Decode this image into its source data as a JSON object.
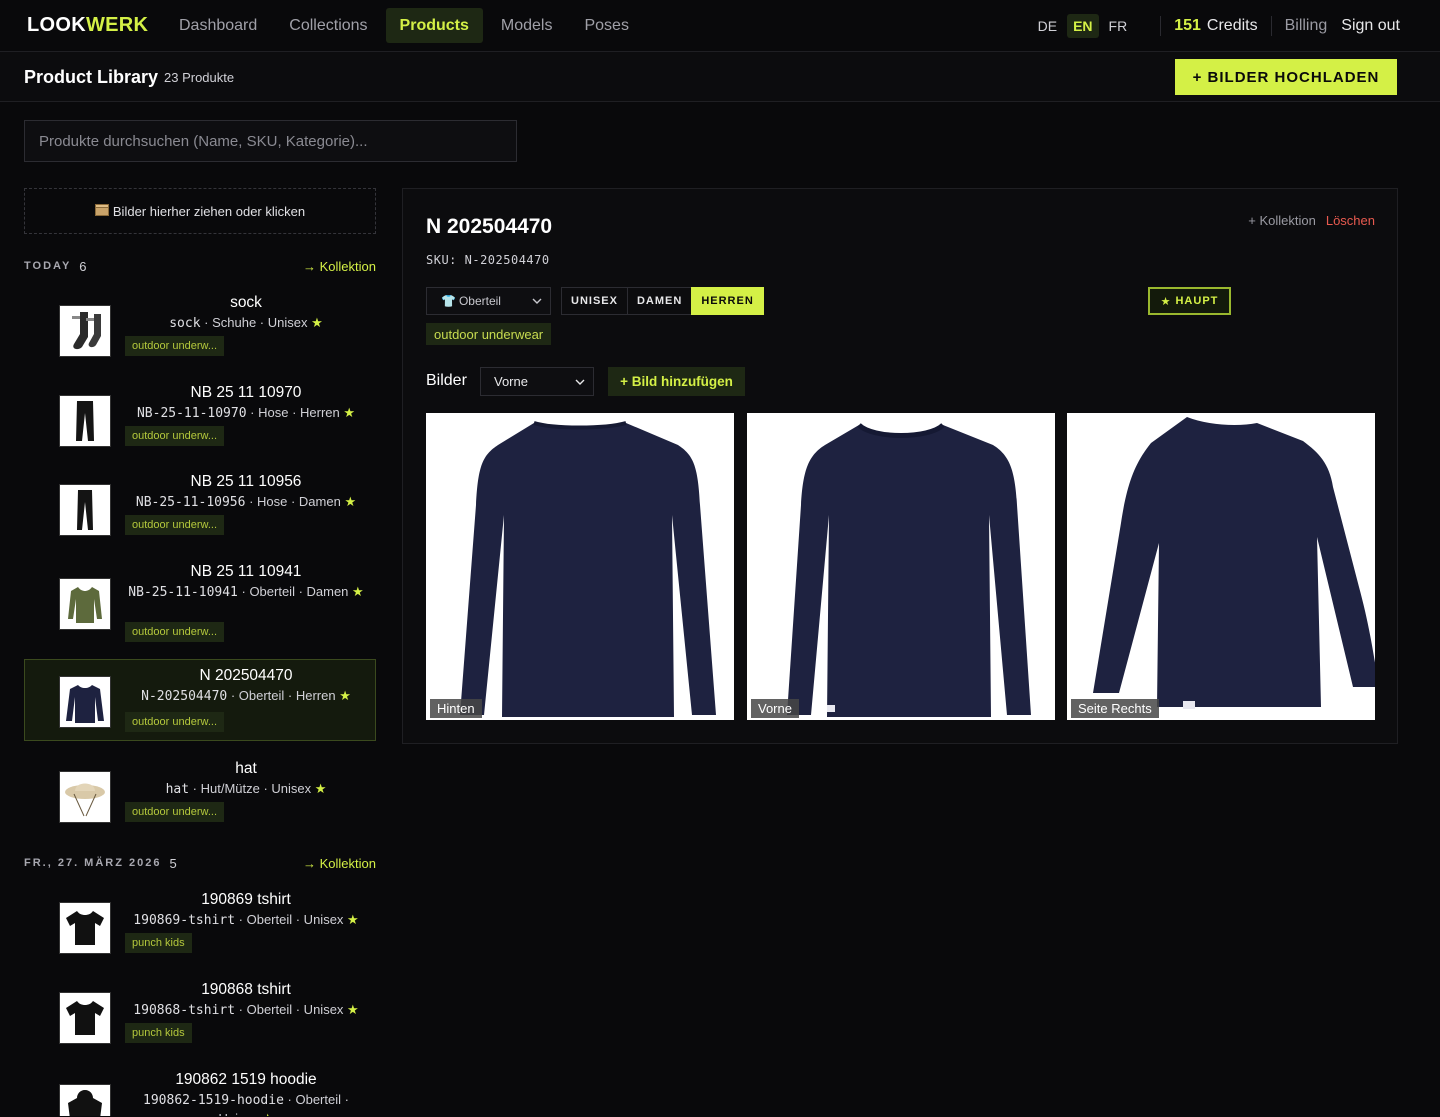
{
  "brand": {
    "logo_a": "LOOK",
    "logo_b": "WERK"
  },
  "nav": {
    "items": [
      "Dashboard",
      "Collections",
      "Products",
      "Models",
      "Poses"
    ],
    "active": "Products"
  },
  "lang": [
    "DE",
    "EN",
    "FR"
  ],
  "lang_active": "EN",
  "credits": {
    "amount": "151",
    "label": "Credits"
  },
  "billing": "Billing",
  "signout": "Sign out",
  "header": {
    "title": "Product Library",
    "count": "23 Produkte",
    "upload": "+ BILDER HOCHLADEN"
  },
  "search": {
    "placeholder": "Produkte durchsuchen (Name, SKU, Kategorie)..."
  },
  "dropzone": {
    "icon": "box-icon",
    "text": "Bilder hierher ziehen oder klicken"
  },
  "groups": [
    {
      "label": "TODAY",
      "count": "6",
      "link": "→ Kollektion"
    },
    {
      "label": "FR., 27. MÄRZ 2026",
      "count": "5",
      "link": "→ Kollektion"
    }
  ],
  "products": [
    {
      "name": "sock",
      "sku": "sock",
      "meta": "Schuhe · Unisex",
      "tag": "outdoor underw...",
      "thumb": "sock"
    },
    {
      "name": "NB 25 11 10970",
      "sku": "NB-25-11-10970",
      "meta": "Hose · Herren",
      "tag": "outdoor underw...",
      "thumb": "pants"
    },
    {
      "name": "NB 25 11 10956",
      "sku": "NB-25-11-10956",
      "meta": "Hose · Damen",
      "tag": "outdoor underw...",
      "thumb": "pants"
    },
    {
      "name": "NB 25 11 10941",
      "sku": "NB-25-11-10941",
      "meta": "Oberteil · Damen",
      "tag": "outdoor underw...",
      "thumb": "olive-top"
    },
    {
      "name": "N 202504470",
      "sku": "N-202504470",
      "meta": "Oberteil · Herren",
      "tag": "outdoor underw...",
      "thumb": "navy-top",
      "selected": true
    },
    {
      "name": "hat",
      "sku": "hat",
      "meta": "Hut/Mütze · Unisex",
      "tag": "outdoor underw...",
      "thumb": "hat"
    },
    {
      "name": "190869 tshirt",
      "sku": "190869-tshirt",
      "meta": "Oberteil · Unisex",
      "tag": "punch kids",
      "thumb": "tshirt"
    },
    {
      "name": "190868 tshirt",
      "sku": "190868-tshirt",
      "meta": "Oberteil · Unisex",
      "tag": "punch kids",
      "thumb": "tshirt"
    },
    {
      "name": "190862 1519 hoodie",
      "sku": "190862-1519-hoodie",
      "meta": "Oberteil · Unisex",
      "tag": "",
      "thumb": "hoodie"
    }
  ],
  "detail": {
    "title": "N 202504470",
    "sku": "SKU: N-202504470",
    "add_collection": "+ Kollektion",
    "delete": "Löschen",
    "category": "Oberteil",
    "genders": [
      "UNISEX",
      "DAMEN",
      "HERREN"
    ],
    "gender_active": "HERREN",
    "main_badge": "HAUPT",
    "collection_tag": "outdoor underwear",
    "images_label": "Bilder",
    "view": "Vorne",
    "add_image": "+ Bild hinzufügen",
    "images": [
      {
        "label": "Hinten",
        "view": "back"
      },
      {
        "label": "Vorne",
        "view": "front"
      },
      {
        "label": "Seite Rechts",
        "view": "side"
      }
    ]
  },
  "colors": {
    "accent": "#d4f046",
    "bg": "#09090b",
    "delete": "#e85a4f",
    "garment": "#1e2240"
  }
}
